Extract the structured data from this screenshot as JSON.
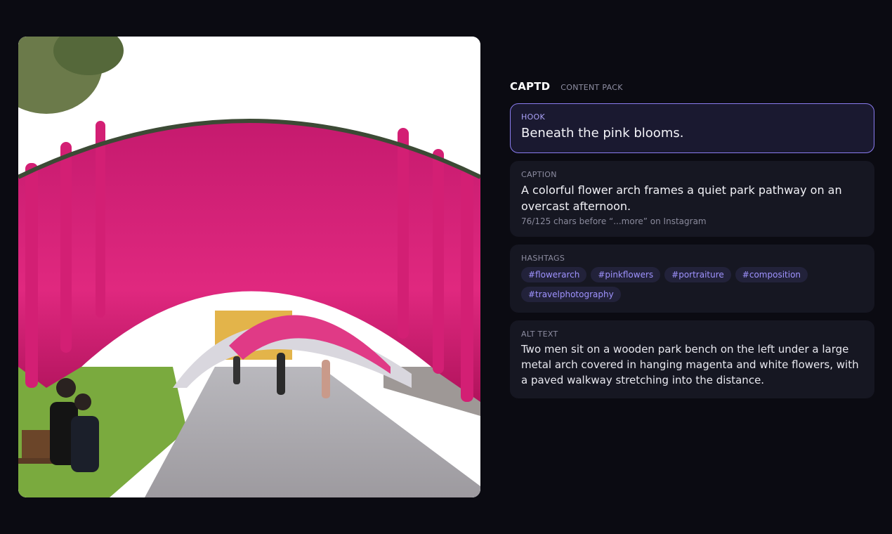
{
  "brand": {
    "name": "CAPTD",
    "subtitle": "CONTENT PACK"
  },
  "colors": {
    "accent": "#8a7cf0",
    "tag_text": "#9f93ff",
    "background": "#0b0b12",
    "card": "#161722"
  },
  "hook": {
    "label": "HOOK",
    "text": "Beneath the pink blooms."
  },
  "caption": {
    "label": "CAPTION",
    "text": "A colorful flower arch frames a quiet park pathway on an overcast afternoon.",
    "meta": "76/125 chars before “...more” on Instagram"
  },
  "hashtags": {
    "label": "HASHTAGS",
    "tags": [
      "#flowerarch",
      "#pinkflowers",
      "#portraiture",
      "#composition",
      "#travelphotography"
    ]
  },
  "alt_text": {
    "label": "ALT TEXT",
    "text": "Two men sit on a wooden park bench on the left under a large metal arch covered in hanging magenta and white flowers, with a paved walkway stretching into the distance."
  }
}
